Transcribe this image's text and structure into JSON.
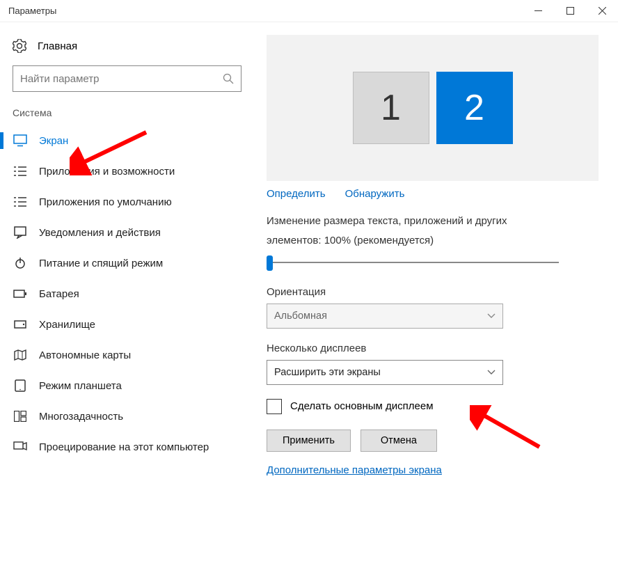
{
  "window": {
    "title": "Параметры"
  },
  "home": {
    "label": "Главная"
  },
  "search": {
    "placeholder": "Найти параметр"
  },
  "section": {
    "label": "Система"
  },
  "sidebar": {
    "items": [
      {
        "label": "Экран"
      },
      {
        "label": "Приложения и возможности"
      },
      {
        "label": "Приложения по умолчанию"
      },
      {
        "label": "Уведомления и действия"
      },
      {
        "label": "Питание и спящий режим"
      },
      {
        "label": "Батарея"
      },
      {
        "label": "Хранилище"
      },
      {
        "label": "Автономные карты"
      },
      {
        "label": "Режим планшета"
      },
      {
        "label": "Многозадачность"
      },
      {
        "label": "Проецирование на этот компьютер"
      }
    ]
  },
  "monitors": {
    "one": "1",
    "two": "2"
  },
  "links": {
    "detect": "Определить",
    "discover": "Обнаружить"
  },
  "scale": {
    "text1": "Изменение размера текста, приложений и других",
    "text2": "элементов: 100% (рекомендуется)"
  },
  "orientation": {
    "label": "Ориентация",
    "value": "Альбомная"
  },
  "multi": {
    "label": "Несколько дисплеев",
    "value": "Расширить эти экраны"
  },
  "primary": {
    "label": "Сделать основным дисплеем"
  },
  "buttons": {
    "apply": "Применить",
    "cancel": "Отмена"
  },
  "advanced": {
    "label": "Дополнительные параметры экрана"
  }
}
